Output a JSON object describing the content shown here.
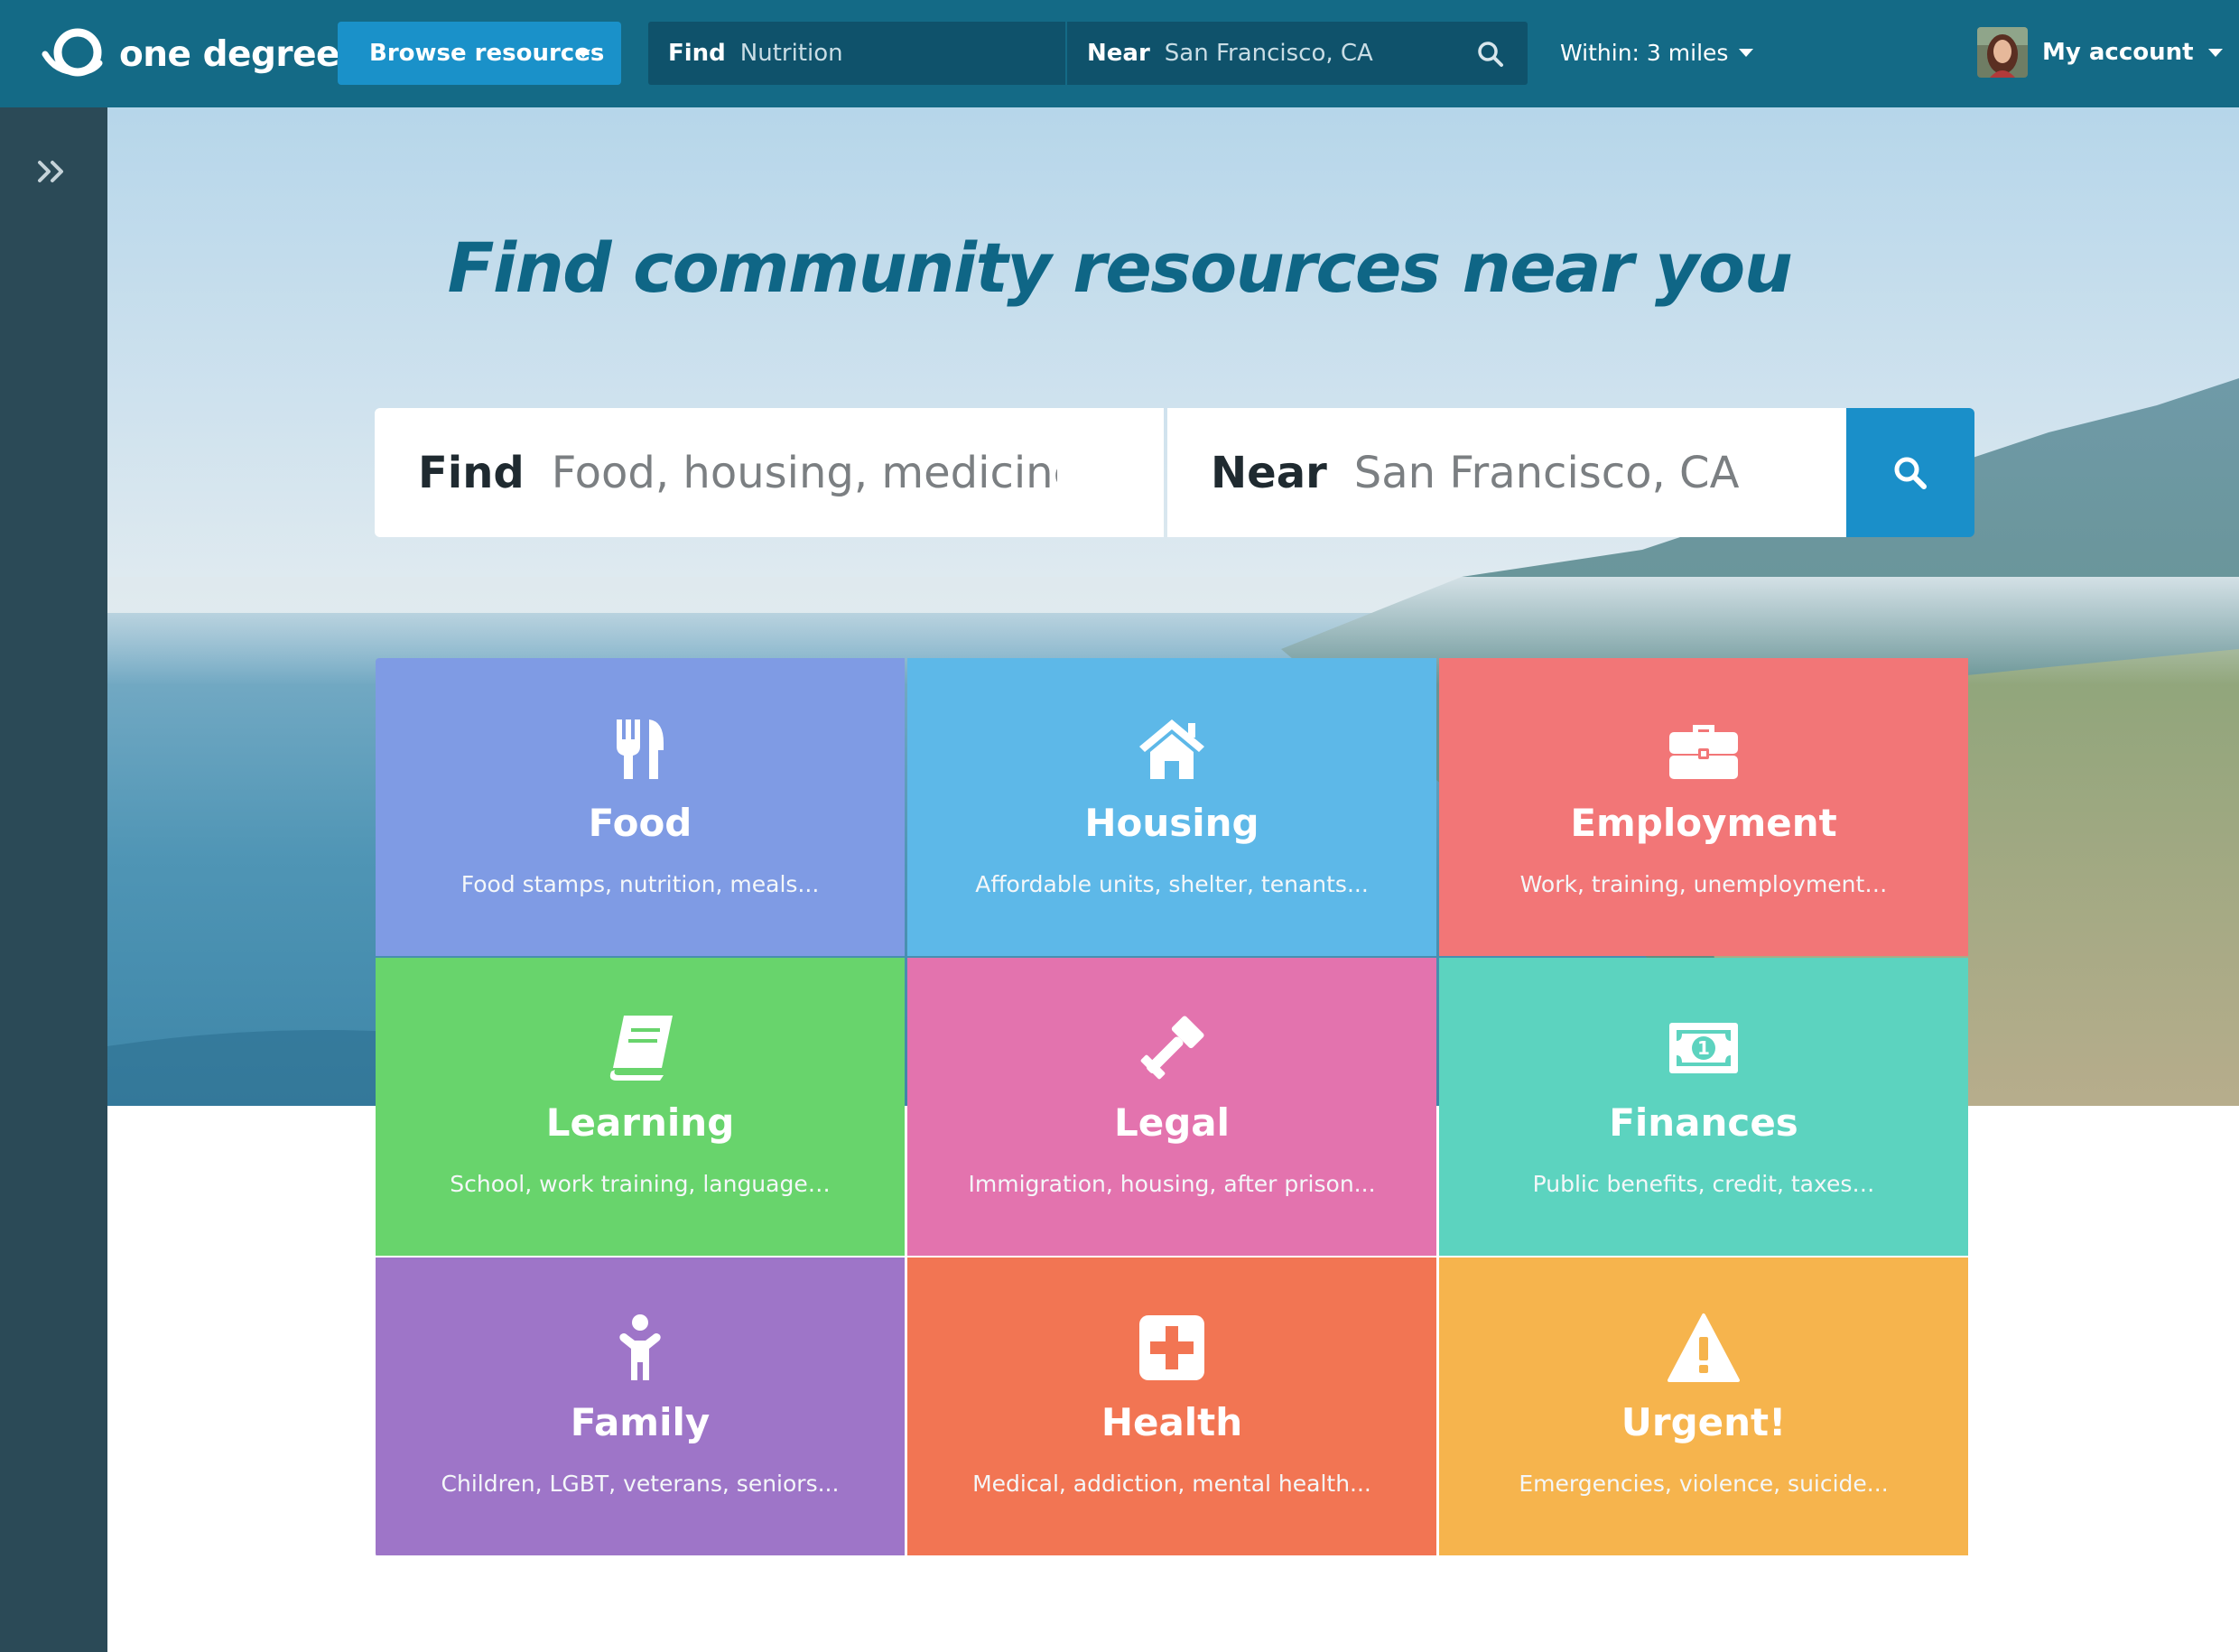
{
  "app": {
    "logo_text": "one degree"
  },
  "topbar": {
    "browse_label": "Browse resources",
    "find_label": "Find",
    "find_value": "Nutrition",
    "near_label": "Near",
    "near_value": "San Francisco, CA",
    "within_label": "Within: 3 miles",
    "account_label": "My account"
  },
  "hero": {
    "headline": "Find community resources near you",
    "find_label": "Find",
    "find_placeholder": "Food, housing, medicine…",
    "near_label": "Near",
    "near_value": "San Francisco, CA"
  },
  "categories": [
    {
      "title": "Food",
      "desc": "Food stamps, nutrition, meals...",
      "color": "#7f9be4",
      "icon": "fork-knife-icon"
    },
    {
      "title": "Housing",
      "desc": "Affordable units, shelter, tenants...",
      "color": "#5db8e8",
      "icon": "house-icon"
    },
    {
      "title": "Employment",
      "desc": "Work, training, unemployment…",
      "color": "#f27677",
      "icon": "briefcase-icon"
    },
    {
      "title": "Learning",
      "desc": "School, work training, language…",
      "color": "#68d46c",
      "icon": "book-icon"
    },
    {
      "title": "Legal",
      "desc": "Immigration, housing, after prison...",
      "color": "#e373ae",
      "icon": "gavel-icon"
    },
    {
      "title": "Finances",
      "desc": "Public benefits, credit, taxes…",
      "color": "#5cd3bf",
      "icon": "dollar-bill-icon"
    },
    {
      "title": "Family",
      "desc": "Children, LGBT, veterans, seniors...",
      "color": "#9e75c8",
      "icon": "child-icon"
    },
    {
      "title": "Health",
      "desc": "Medical, addiction, mental health...",
      "color": "#f27553",
      "icon": "medical-cross-icon"
    },
    {
      "title": "Urgent!",
      "desc": "Emergencies, violence, suicide...",
      "color": "#f6b44d",
      "icon": "warning-icon"
    }
  ]
}
